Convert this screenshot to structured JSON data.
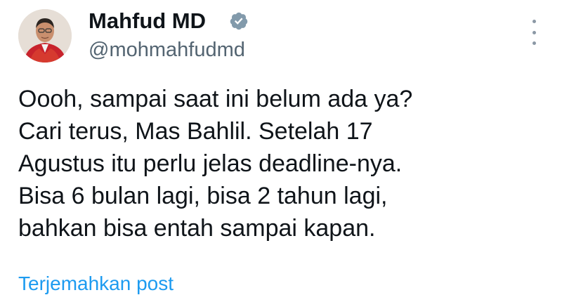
{
  "author": {
    "display_name": "Mahfud MD",
    "handle": "@mohmahfudmd",
    "verified": true,
    "avatar_icon": "profile-photo",
    "verified_icon": "verified-badge-icon"
  },
  "tweet": {
    "lines": [
      "Oooh, sampai saat ini belum ada ya?",
      "Cari terus, Mas Bahlil. Setelah 17",
      "Agustus itu perlu jelas deadline-nya.",
      "Bisa 6 bulan lagi, bisa 2 tahun lagi,",
      "bahkan bisa entah sampai kapan."
    ]
  },
  "translate_link": "Terjemahkan post",
  "colors": {
    "text": "#0f1419",
    "secondary": "#536471",
    "link": "#1d9bf0",
    "badge": "#829aab"
  }
}
